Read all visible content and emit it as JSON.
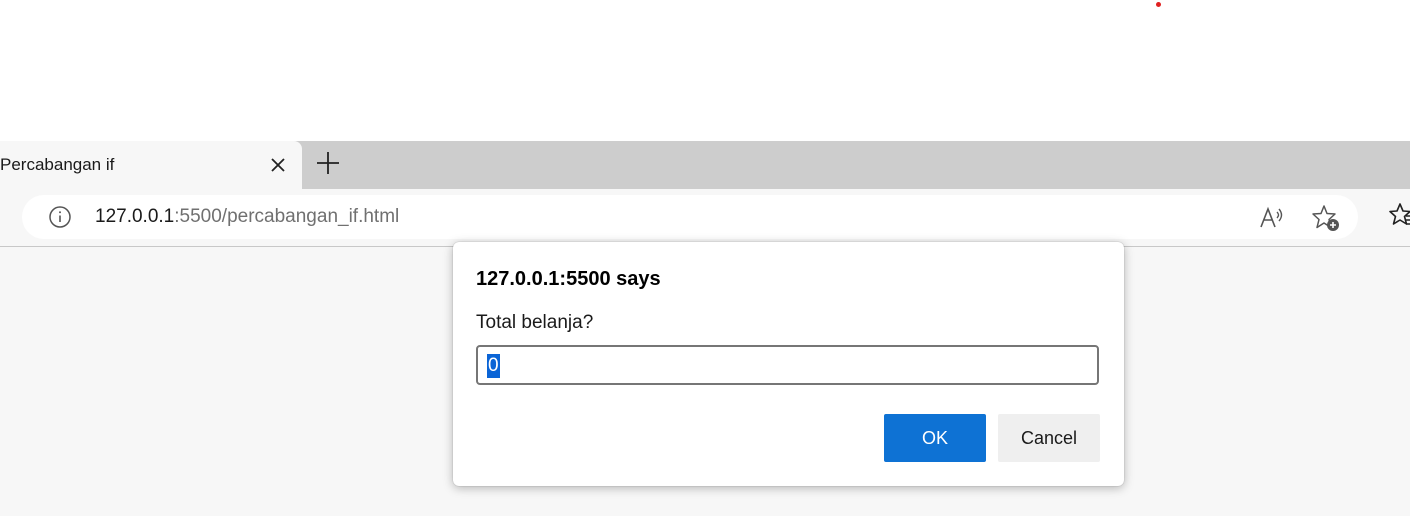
{
  "browser": {
    "tab": {
      "title": "Percabangan if"
    },
    "address": {
      "host": "127.0.0.1",
      "rest": ":5500/percabangan_if.html"
    }
  },
  "dialog": {
    "title": "127.0.0.1:5500 says",
    "message": "Total belanja?",
    "input_value": "0",
    "ok_label": "OK",
    "cancel_label": "Cancel"
  },
  "colors": {
    "accent": "#0e72d4",
    "selection": "#0a64d6",
    "tabstrip": "#cdcdcd"
  }
}
